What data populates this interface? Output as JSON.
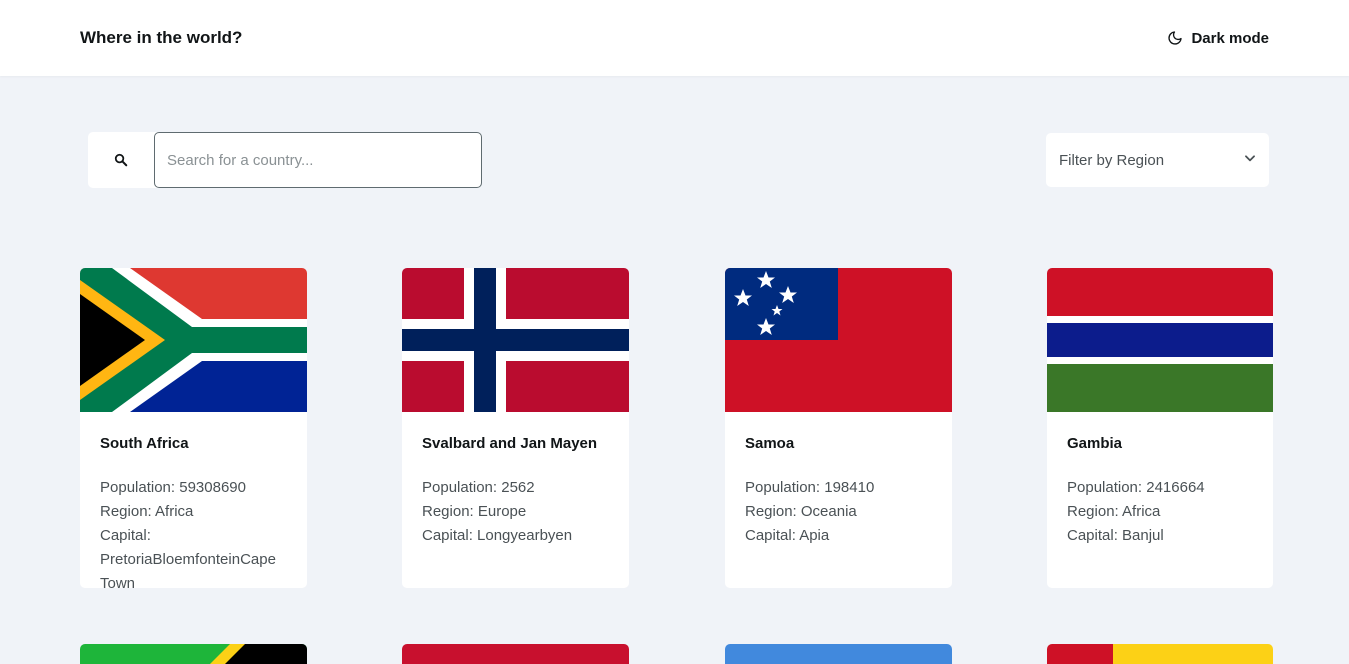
{
  "header": {
    "title": "Where in the world?",
    "dark_mode_label": "Dark mode",
    "dark_mode_icon": "moon-icon"
  },
  "search": {
    "placeholder": "Search for a country...",
    "icon": "search-icon"
  },
  "filter": {
    "label": "Filter by Region",
    "icon": "chevron-down-icon"
  },
  "labels": {
    "population": "Population:",
    "region": "Region:",
    "capital": "Capital:"
  },
  "countries": [
    {
      "name": "South Africa",
      "population": "59308690",
      "region": "Africa",
      "capital": "PretoriaBloemfonteinCape Town"
    },
    {
      "name": "Svalbard and Jan Mayen",
      "population": "2562",
      "region": "Europe",
      "capital": "Longyearbyen"
    },
    {
      "name": "Samoa",
      "population": "198410",
      "region": "Oceania",
      "capital": "Apia"
    },
    {
      "name": "Gambia",
      "population": "2416664",
      "region": "Africa",
      "capital": "Banjul"
    }
  ],
  "colors": {
    "background": "#f0f3f8",
    "surface": "#ffffff",
    "text": "#111517",
    "muted": "#4a5155"
  }
}
